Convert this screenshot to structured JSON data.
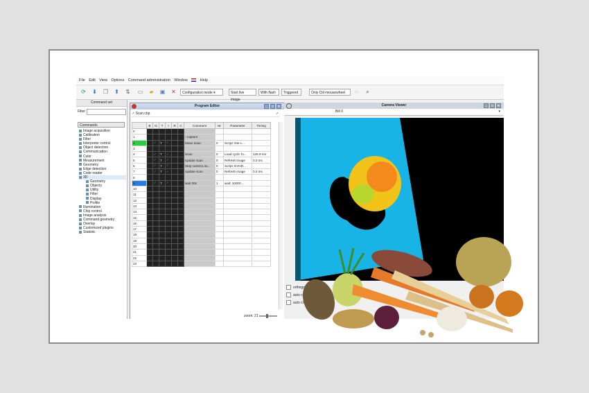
{
  "menu": [
    "File",
    "Edit",
    "View",
    "Options",
    "Command administration",
    "Window",
    "Help"
  ],
  "toolbar": {
    "mode_select": "Configuration mode",
    "start_live": "Start live image",
    "with_flash": "With flash",
    "triggered": "Triggered",
    "ctrl_mousewheel": "Only Ctrl-mousewheel"
  },
  "command_panel": {
    "title": "Command set",
    "filter_label": "Filter",
    "header": "Commands",
    "items": [
      "Image acquisition",
      "Calibration",
      "Filter",
      "Interpreter control",
      "Object detection",
      "Communication",
      "Color",
      "Measurement",
      "Geometry",
      "Edge detection",
      "Code reader",
      "3D"
    ],
    "sub_items": [
      "Geometry",
      "Objects",
      "Utility",
      "Filter",
      "Display",
      "Profile"
    ],
    "items_after": [
      "Illumination",
      "Chip control",
      "Image analysis",
      "Command geometry",
      "Overlay",
      "Customized plugins",
      "Statistic"
    ]
  },
  "program_editor": {
    "title": "Program Editor",
    "file": "Scan.cbp",
    "columns": [
      "",
      "B",
      "G",
      "T",
      "I",
      "R",
      "C",
      "Comment",
      "Nr",
      "Parameter",
      "Timing"
    ],
    "rows": [
      {
        "n": "0",
        "comment": "",
        "nr": "",
        "param": "",
        "timing": ""
      },
      {
        "n": "1",
        "comment": "--capture",
        "nr": "",
        "param": "",
        "timing": ""
      },
      {
        "n": "2",
        "comment": "Move Scan",
        "nr": "0",
        "param": "Script: Die-c...",
        "timing": ""
      },
      {
        "n": "3",
        "comment": "",
        "nr": "",
        "param": "",
        "timing": ""
      },
      {
        "n": "4",
        "comment": "Scan",
        "nr": "0",
        "param": "Load cyclic fo...",
        "timing": "135.9 ms"
      },
      {
        "n": "5",
        "comment": "Update scan",
        "nr": "0",
        "param": "Refresh image",
        "timing": "0.0 ms"
      },
      {
        "n": "6",
        "comment": "Stop camera an...",
        "nr": "0",
        "param": "Script: EVHD...",
        "timing": ""
      },
      {
        "n": "7",
        "comment": "Update scan",
        "nr": "0",
        "param": "Refresh image",
        "timing": "0.0 ms"
      },
      {
        "n": "8",
        "comment": "",
        "nr": "",
        "param": "",
        "timing": ""
      },
      {
        "n": "9",
        "comment": "wait 20s",
        "nr": "1",
        "param": "wait: 10000 ...",
        "timing": ""
      },
      {
        "n": "10",
        "comment": "",
        "nr": "",
        "param": "",
        "timing": ""
      },
      {
        "n": "11",
        "comment": "",
        "nr": "",
        "param": "",
        "timing": ""
      },
      {
        "n": "12",
        "comment": "",
        "nr": "",
        "param": "",
        "timing": ""
      },
      {
        "n": "13",
        "comment": "",
        "nr": "",
        "param": "",
        "timing": ""
      },
      {
        "n": "14",
        "comment": "",
        "nr": "",
        "param": "",
        "timing": ""
      },
      {
        "n": "15",
        "comment": "",
        "nr": "",
        "param": "",
        "timing": ""
      },
      {
        "n": "16",
        "comment": "",
        "nr": "",
        "param": "",
        "timing": ""
      },
      {
        "n": "17",
        "comment": "",
        "nr": "",
        "param": "",
        "timing": ""
      },
      {
        "n": "18",
        "comment": "",
        "nr": "",
        "param": "",
        "timing": ""
      },
      {
        "n": "19",
        "comment": "",
        "nr": "",
        "param": "",
        "timing": ""
      },
      {
        "n": "20",
        "comment": "",
        "nr": "",
        "param": "",
        "timing": ""
      },
      {
        "n": "21",
        "comment": "",
        "nr": "",
        "param": "",
        "timing": ""
      },
      {
        "n": "22",
        "comment": "",
        "nr": "",
        "param": "",
        "timing": ""
      },
      {
        "n": "23",
        "comment": "",
        "nr": "",
        "param": "",
        "timing": ""
      }
    ],
    "zoom": "zoom: 21"
  },
  "camera_viewer": {
    "title": "Camera Viewer",
    "tab": "Bill 0",
    "options": [
      "orthogon",
      "auto contr",
      "auto color"
    ]
  },
  "colors": {
    "accent_green": "#2ecc40",
    "selected_blue": "#2a7be4",
    "scan_cyan": "#19b4e6"
  }
}
